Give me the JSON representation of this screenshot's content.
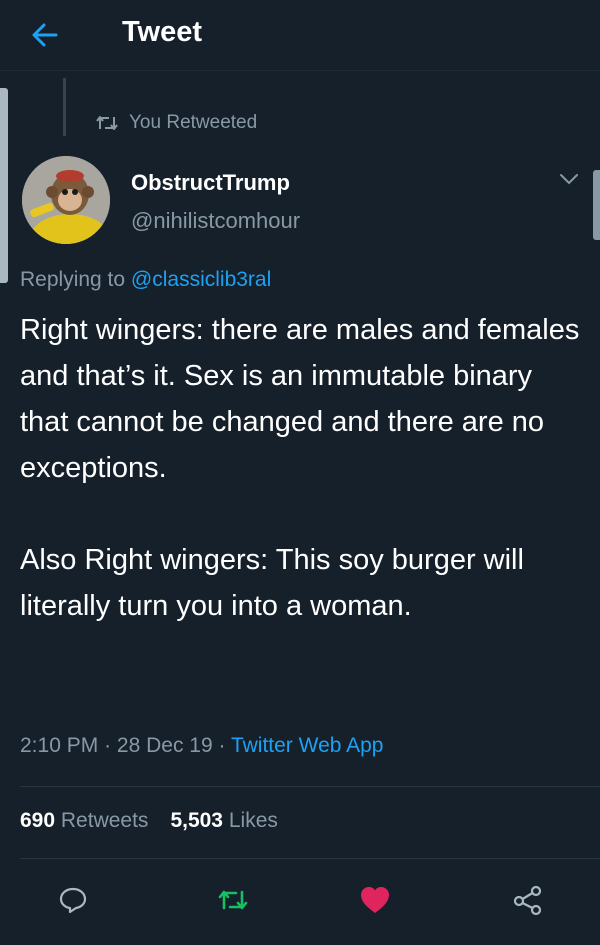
{
  "header": {
    "title": "Tweet"
  },
  "context": {
    "retweeted_label": "You Retweeted"
  },
  "author": {
    "display_name": "ObstructTrump",
    "handle": "@nihilistcomhour"
  },
  "reply": {
    "prefix": "Replying to",
    "to_handle": "@classiclib3ral"
  },
  "tweet": {
    "paragraph_1": "Right wingers: there are males and females and that’s it. Sex is an immutable binary that cannot be changed and there are no exceptions.",
    "paragraph_2": "Also Right wingers: This soy burger will literally turn you into a woman."
  },
  "meta": {
    "time": "2:10 PM",
    "sep1": "·",
    "date": "28 Dec 19",
    "sep2": "·",
    "source": "Twitter Web App"
  },
  "stats": {
    "retweets_count": "690",
    "retweets_label": "Retweets",
    "likes_count": "5,503",
    "likes_label": "Likes"
  },
  "colors": {
    "background": "#15202b",
    "accent": "#1da1f2",
    "muted": "#8899a6",
    "retweet_active": "#17bf63",
    "like_active": "#e0245e"
  },
  "icons": [
    "back-arrow-icon",
    "retweet-icon",
    "chevron-down-icon",
    "reply-icon",
    "like-icon",
    "share-icon"
  ]
}
